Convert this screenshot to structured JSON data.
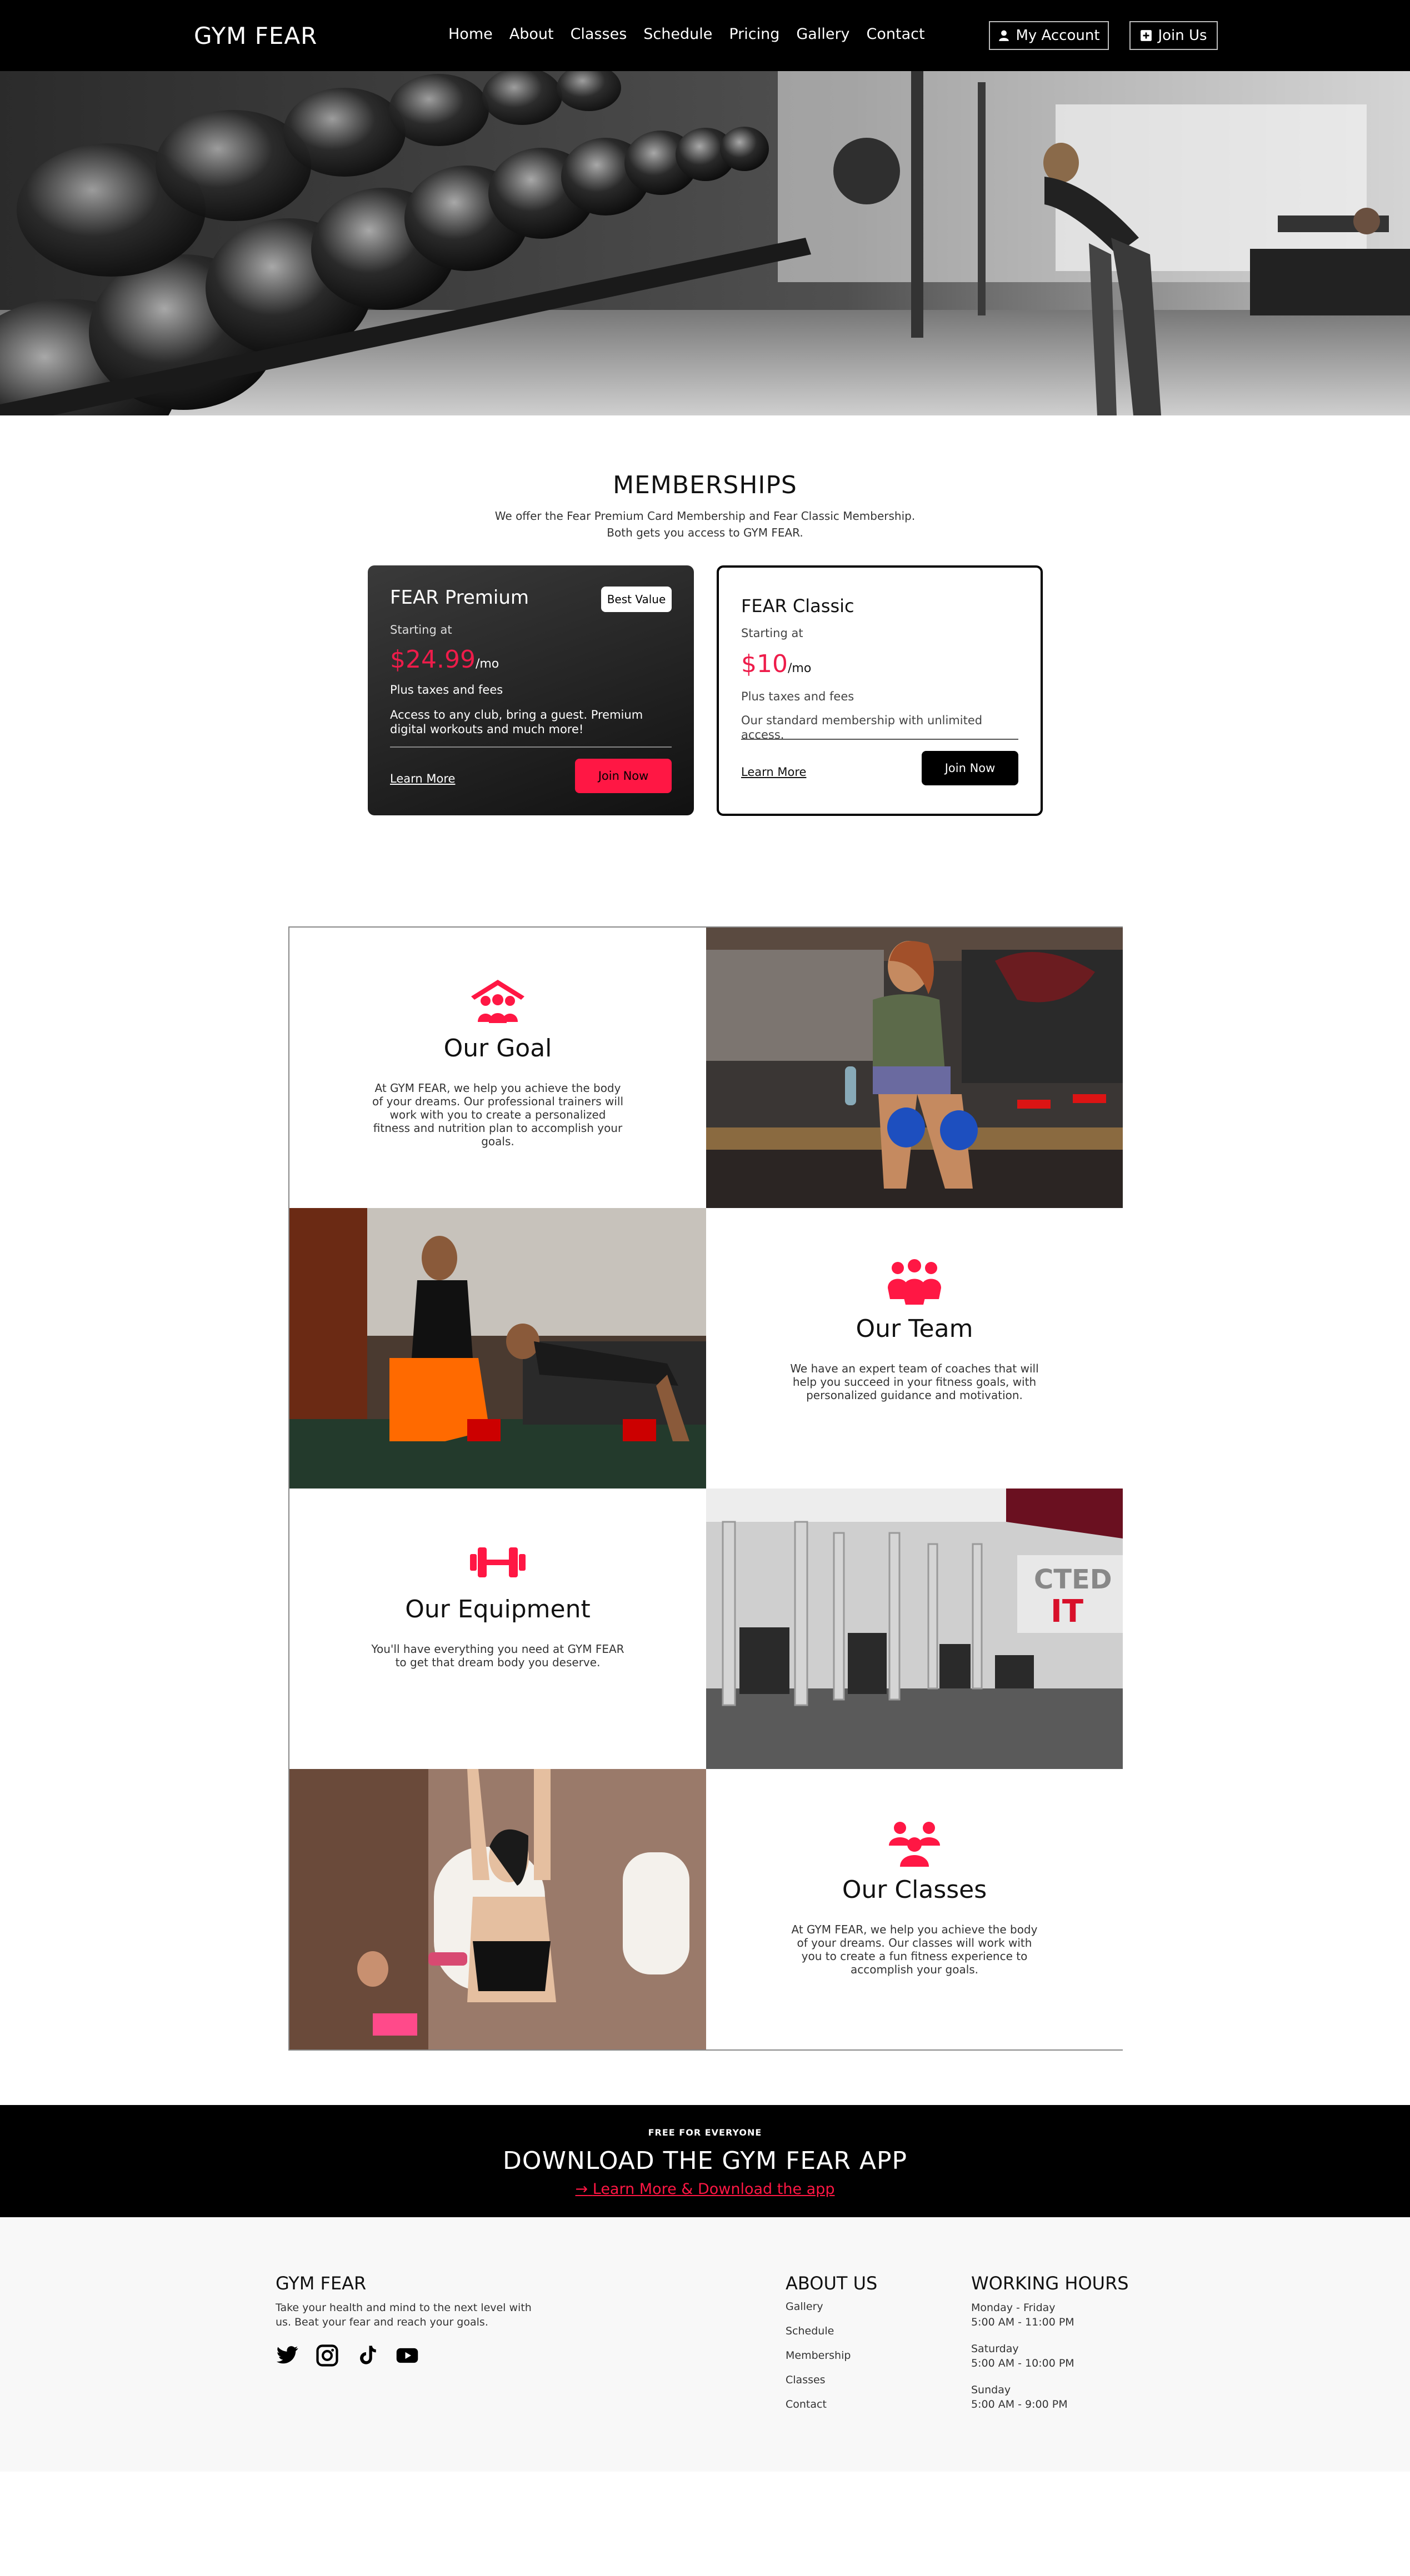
{
  "nav": {
    "brand": "GYM FEAR",
    "links": [
      "Home",
      "About",
      "Classes",
      "Schedule",
      "Pricing",
      "Gallery",
      "Contact"
    ],
    "account_label": "My Account",
    "join_label": "Join Us"
  },
  "memberships": {
    "title": "MEMBERSHIPS",
    "subtitle_line1": "We offer the Fear Premium Card Membership and Fear Classic Membership.",
    "subtitle_line2": "Both gets you access to GYM FEAR.",
    "premium": {
      "name": "FEAR Premium",
      "badge": "Best Value",
      "starting": "Starting at",
      "price": "$24.99",
      "per": "/mo",
      "tax": "Plus taxes and fees",
      "desc": "Access to any club, bring a guest. Premium digital workouts and much more!",
      "learn": "Learn More",
      "join": "Join Now"
    },
    "classic": {
      "name": "FEAR Classic",
      "starting": "Starting at",
      "price": "$10",
      "per": "/mo",
      "tax": "Plus taxes and fees",
      "desc": "Our standard membership with unlimited access.",
      "learn": "Learn More",
      "join": "Join Now"
    }
  },
  "features": {
    "goal": {
      "title": "Our Goal",
      "body": "At GYM FEAR, we help you achieve the body of your dreams. Our professional trainers will work with you to create a personalized fitness and nutrition plan to accomplish your goals."
    },
    "team": {
      "title": "Our Team",
      "body": "We have an expert team of coaches that will help you succeed in your fitness goals, with personalized guidance and motivation."
    },
    "equipment": {
      "title": "Our Equipment",
      "body": "You'll have everything you need at GYM FEAR to get that dream body you deserve."
    },
    "classes": {
      "title": "Our Classes",
      "body": "At GYM FEAR, we help you achieve the body of your dreams. Our classes will work with you to create a fun fitness experience to accomplish your goals."
    }
  },
  "app": {
    "kicker": "FREE FOR EVERYONE",
    "title": "DOWNLOAD THE GYM FEAR APP",
    "link": "Learn More & Download the app"
  },
  "footer": {
    "brand": "GYM FEAR",
    "tagline": "Take your health and mind to the next level with us. Beat your fear and reach your goals.",
    "about_title": "ABOUT US",
    "about_links": [
      "Gallery",
      "Schedule",
      "Membership",
      "Classes",
      "Contact"
    ],
    "hours_title": "WORKING HOURS",
    "hours": [
      {
        "day": "Monday - Friday",
        "time": "5:00 AM - 11:00 PM"
      },
      {
        "day": "Saturday",
        "time": "5:00 AM - 10:00 PM"
      },
      {
        "day": "Sunday",
        "time": "5:00 AM - 9:00 PM"
      }
    ]
  },
  "colors": {
    "accent": "#ff1744",
    "black": "#000000",
    "footer_bg": "#f8f8f8"
  },
  "icons": {
    "account": "user-icon",
    "join": "plus-square-icon",
    "goal": "house-family-icon",
    "team": "group-icon",
    "equipment": "dumbbell-icon",
    "classes": "people-icon",
    "social": [
      "twitter-icon",
      "instagram-icon",
      "tiktok-icon",
      "youtube-icon"
    ]
  }
}
